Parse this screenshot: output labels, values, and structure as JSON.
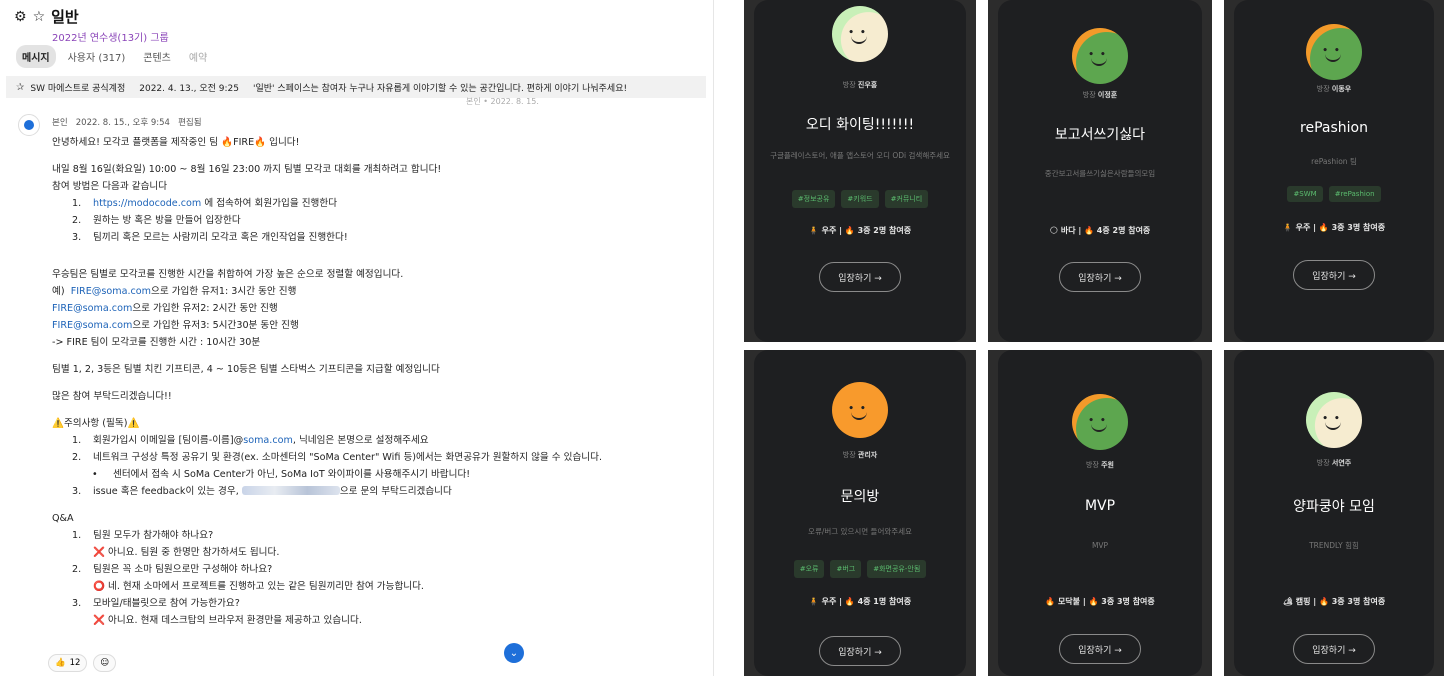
{
  "channel": {
    "title": "일반",
    "group": "2022년 연수생(13기) 그룹",
    "tabs": [
      "메시지",
      "사용자 (317)",
      "콘텐츠",
      "예약"
    ]
  },
  "pinned": {
    "author": "SW 마에스트로 공식계정",
    "date": "2022. 4. 13., 오전 9:25",
    "text": "'일반' 스페이스는 참여자 누구나 자유롭게 이야기할 수 있는 공간입니다. 편하게 이야기 나눠주세요!"
  },
  "ghost_text": "본인 • 2022. 8. 15.",
  "message": {
    "author": "본인",
    "time": "2022. 8. 15., 오후 9:54",
    "edited": "편집됨",
    "lines": [
      "안녕하세요! 모각코 플랫폼을 제작중인 팀 🔥FIRE🔥 입니다!",
      "내일 8월 16일(화요일) 10:00 ~ 8월 16일 23:00 까지 팀별 모각코 대회를 개최하려고 합니다!",
      "참여 방법은 다음과 같습니다",
      "에 접속하여 회원가입을 진행한다",
      "원하는 방 혹은 방을 만들어 입장한다",
      "팀끼리 혹은 모르는 사람끼리 모각코 혹은 개인작업을 진행한다!",
      "우승팀은 팀별로 모각코를 진행한 시간을 취합하여 가장 높은 순으로 정렬할 예정입니다.",
      "예)",
      "으로 가입한 유저1: 3시간 동안 진행",
      "으로 가입한 유저2: 2시간 동안 진행",
      "으로 가입한 유저3: 5시간30분 동안 진행",
      "-> FIRE 팀이 모각코를 진행한 시간 : 10시간 30분",
      "팀별 1, 2, 3등은 팀별 치킨 기프티콘, 4 ~ 10등은 팀별 스타벅스 기프티콘을 지급할 예정입니다",
      "많은 참여 부탁드리겠습니다!!",
      "⚠️주의사항 (필독)⚠️",
      "회원가입시 이메일을 [팀이름-이름]@",
      ", 닉네임은 본명으로 설정해주세요",
      "네트워크 구성상 특정 공유기 및 환경(ex. 소마센터의 \"SoMa Center\" Wifi 등)에서는 화면공유가 원할하지 않을 수 있습니다.",
      "센터에서 접속 시 SoMa Center가 아닌, SoMa IoT 와이파이를 사용해주시기 바랍니다!",
      "issue 혹은 feedback이 있는 경우,",
      "으로 문의 부탁드리겠습니다",
      "Q&A",
      "팀원 모두가 참가해야 하나요?",
      "❌ 아니요. 팀원 중 한명만 참가하셔도 됩니다.",
      "팀원은 꼭 소마 팀원으로만 구성해야 하나요?",
      "⭕ 네. 현재 소마에서 프로젝트를 진행하고 있는 같은 팀원끼리만 참여 가능합니다.",
      "모바일/태블릿으로 참여 가능한가요?",
      "❌ 아니요. 현재 데스크탑의 브라우저 환경만을 제공하고 있습니다."
    ],
    "link_url": "https://modocode.com",
    "email": "FIRE@soma.com",
    "email_domain": "soma.com",
    "nums": [
      "1.",
      "2.",
      "3.",
      "•"
    ],
    "reaction_count": "12"
  },
  "cards": [
    {
      "owner_label": "방장",
      "owner": "진우홍",
      "title": "오디 화이팅!!!!!!!",
      "desc": "구글플레이스토어, 애플 앱스토어 오디 ODi 검색해주세요",
      "tags": [
        "#정보공유",
        "#키워드",
        "#커뮤니티"
      ],
      "stats": "🧍 우주 | 🔥 3중 2명 참여중",
      "enter": "입장하기 →",
      "face": "mint"
    },
    {
      "owner_label": "방장",
      "owner": "이정훈",
      "title": "보고서쓰기싫다",
      "desc": "중간보고서를쓰기싫은사람들의모임",
      "tags": [],
      "stats": "🌕 바다 | 🔥 4중 2명 참여중",
      "enter": "입장하기 →",
      "face": "greenorange"
    },
    {
      "owner_label": "방장",
      "owner": "이동우",
      "title": "rePashion",
      "desc": "rePashion 팀",
      "tags": [
        "#SWM",
        "#rePashion"
      ],
      "stats": "🧍 우주 | 🔥 3중 3명 참여중",
      "enter": "입장하기 →",
      "face": "greenorange"
    },
    {
      "owner_label": "방장",
      "owner": "관리자",
      "title": "문의방",
      "desc": "오류/버그 있으시면 들어와주세요",
      "tags": [
        "#오류",
        "#버그",
        "#화면공유-안됨"
      ],
      "stats": "🧍 우주 | 🔥 4중 1명 참여중",
      "enter": "입장하기 →",
      "face": "orange"
    },
    {
      "owner_label": "방장",
      "owner": "주원",
      "title": "MVP",
      "desc": "MVP",
      "tags": [],
      "stats": "🔥 모닥불 | 🔥 3중 3명 참여중",
      "enter": "입장하기 →",
      "face": "greenorange"
    },
    {
      "owner_label": "방장",
      "owner": "서연주",
      "title": "양파쿵야 모임",
      "desc": "TRENDLY 힘힘",
      "tags": [],
      "stats": "🏕 캠핑 | 🔥 3중 3명 참여중",
      "enter": "입장하기 →",
      "face": "mint"
    }
  ]
}
